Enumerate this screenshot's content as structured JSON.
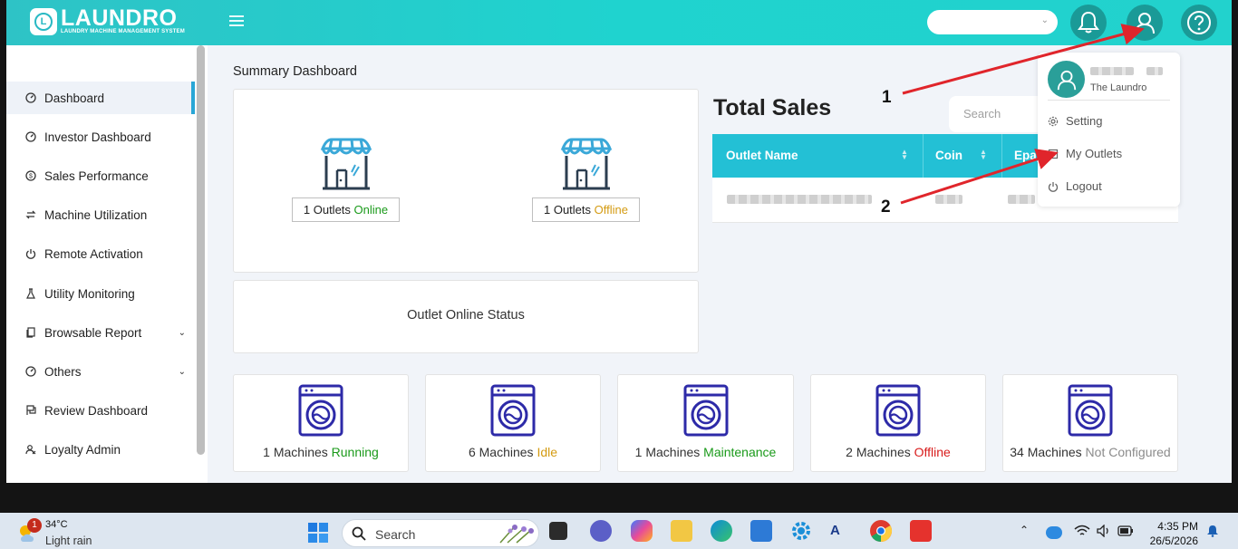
{
  "app": {
    "logo_name": "LAUNDRO",
    "logo_tagline": "LAUNDRY MACHINE MANAGEMENT SYSTEM",
    "logo_letter": "L"
  },
  "topbar": {
    "select_value": "",
    "icons": [
      "bell-icon",
      "user-icon",
      "help-icon"
    ]
  },
  "sidebar": {
    "items": [
      {
        "label": "Dashboard",
        "icon": "dashboard-icon",
        "active": true
      },
      {
        "label": "Investor Dashboard",
        "icon": "gauge-icon"
      },
      {
        "label": "Sales Performance",
        "icon": "dollar-icon"
      },
      {
        "label": "Machine Utilization",
        "icon": "swap-icon"
      },
      {
        "label": "Remote Activation",
        "icon": "power-icon"
      },
      {
        "label": "Utility Monitoring",
        "icon": "flask-icon"
      },
      {
        "label": "Browsable Report",
        "icon": "report-icon",
        "expandable": true
      },
      {
        "label": "Others",
        "icon": "dashboard-icon",
        "expandable": true
      },
      {
        "label": "Review Dashboard",
        "icon": "flag-icon"
      },
      {
        "label": "Loyalty Admin",
        "icon": "users-icon"
      }
    ]
  },
  "main": {
    "page_title": "Summary Dashboard",
    "outlets": {
      "online_count": "1 Outlets ",
      "online_word": "Online",
      "offline_count": "1 Outlets ",
      "offline_word": "Offline"
    },
    "outlet_status_title": "Outlet Online Status",
    "machines": [
      {
        "count": "1 Machines ",
        "status": "Running",
        "color": "#1a9a1a"
      },
      {
        "count": "6 Machines ",
        "status": "Idle",
        "color": "#d49b12"
      },
      {
        "count": "1 Machines ",
        "status": "Maintenance",
        "color": "#1a9a1a"
      },
      {
        "count": "2 Machines ",
        "status": "Offline",
        "color": "#d81b1b"
      },
      {
        "count": "34 Machines ",
        "status": "Not Configured",
        "color": "#8b8b8b"
      }
    ],
    "total_sales": {
      "title": "Total Sales",
      "search_placeholder": "Search",
      "columns": [
        "Outlet Name",
        "Coin",
        "Epay"
      ]
    }
  },
  "dropdown": {
    "company": "The Laundro",
    "items": [
      {
        "label": "Setting",
        "icon": "gear-icon"
      },
      {
        "label": "My Outlets",
        "icon": "store-icon"
      },
      {
        "label": "Logout",
        "icon": "power-icon"
      }
    ]
  },
  "annotations": {
    "arrow_1": "1",
    "arrow_2": "2",
    "arrow_color": "#e0252b"
  },
  "taskbar": {
    "weather_badge": "1",
    "weather_temp": "34°C",
    "weather_desc": "Light rain",
    "search_label": "Search",
    "time": "4:35 PM",
    "date": "26/5/2026"
  },
  "colors": {
    "accent": "#23c0d5",
    "machine_icon": "#2d2aa8",
    "outlet_icon": "#3aa8d8"
  }
}
